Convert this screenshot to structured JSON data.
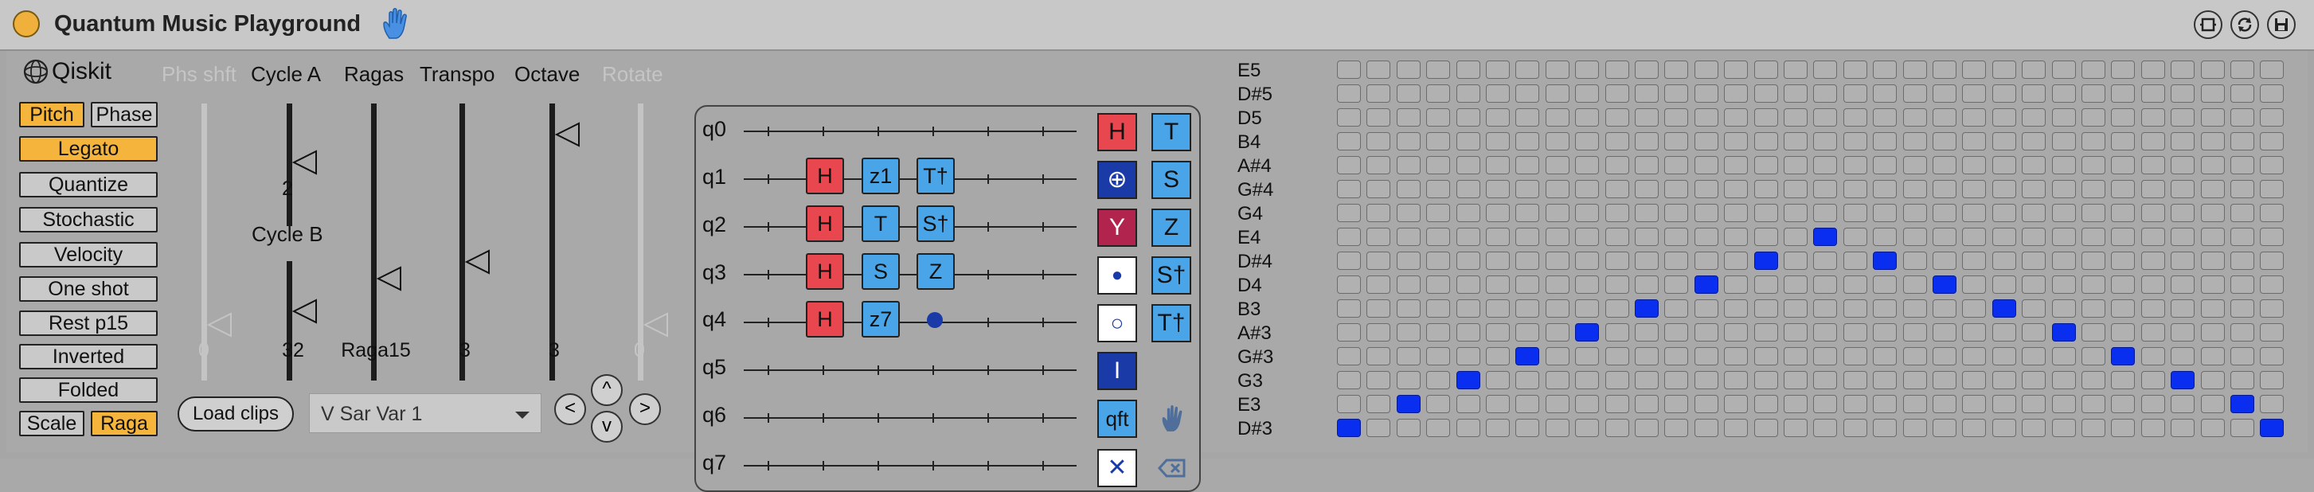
{
  "window": {
    "title": "Quantum Music Playground"
  },
  "left_panel": {
    "logo_text": "Qiskit",
    "buttons": [
      {
        "label": "Pitch",
        "on": true
      },
      {
        "label": "Phase",
        "on": false
      },
      {
        "label": "Legato",
        "on": true
      },
      {
        "label": "Quantize",
        "on": false
      },
      {
        "label": "Stochastic",
        "on": false
      },
      {
        "label": "Velocity",
        "on": false
      },
      {
        "label": "One shot",
        "on": false
      },
      {
        "label": "Rest p15",
        "on": false
      },
      {
        "label": "Inverted",
        "on": false
      },
      {
        "label": "Folded",
        "on": false
      },
      {
        "label": "Scale",
        "on": false
      },
      {
        "label": "Raga",
        "on": true
      }
    ]
  },
  "controls": {
    "phs_shft": {
      "label": "Phs shft",
      "value": "0"
    },
    "cycle_a": {
      "label": "Cycle A",
      "value": "2"
    },
    "cycle_b": {
      "label": "Cycle B",
      "value": "32"
    },
    "ragas": {
      "label": "Ragas",
      "value": "Raga15"
    },
    "transpo": {
      "label": "Transpo",
      "value": "3"
    },
    "octave": {
      "label": "Octave",
      "value": "3"
    },
    "rotate": {
      "label": "Rotate",
      "value": "0"
    }
  },
  "bottom": {
    "load_clips": "Load clips",
    "clip_select": "V Sar Var 1",
    "nav": {
      "up": "^",
      "left": "<",
      "right": ">",
      "down": "v"
    }
  },
  "circuit": {
    "qubits": [
      "q0",
      "q1",
      "q2",
      "q3",
      "q4",
      "q5",
      "q6",
      "q7"
    ],
    "gates": {
      "q1": [
        "H",
        "z1",
        "T†"
      ],
      "q2": [
        "H",
        "T",
        "S†"
      ],
      "q3": [
        "H",
        "S",
        "Z"
      ],
      "q4": [
        "H",
        "z7"
      ]
    },
    "palette_left": [
      "H",
      "⊕",
      "Y",
      "●",
      "○",
      "I",
      "qft",
      "hand-icon",
      "✕"
    ],
    "palette_right": [
      "T",
      "S",
      "Z",
      "S†",
      "T†"
    ]
  },
  "notes": [
    "E5",
    "D#5",
    "D5",
    "B4",
    "A#4",
    "G#4",
    "G4",
    "E4",
    "D#4",
    "D4",
    "B3",
    "A#3",
    "G#3",
    "G3",
    "E3",
    "D#3"
  ],
  "grid": {
    "columns": 32,
    "active_cells": [
      [
        0,
        15
      ],
      [
        2,
        14
      ],
      [
        4,
        13
      ],
      [
        6,
        12
      ],
      [
        8,
        11
      ],
      [
        10,
        10
      ],
      [
        12,
        9
      ],
      [
        14,
        8
      ],
      [
        16,
        7
      ],
      [
        18,
        8
      ],
      [
        20,
        9
      ],
      [
        22,
        10
      ],
      [
        24,
        11
      ],
      [
        26,
        12
      ],
      [
        28,
        13
      ],
      [
        30,
        14
      ],
      [
        31,
        15
      ]
    ]
  },
  "colors": {
    "accent": "#f5b53c",
    "red_gate": "#e8474f",
    "blue_gate": "#4aa5e8",
    "grid_on": "#0a2ef0"
  }
}
